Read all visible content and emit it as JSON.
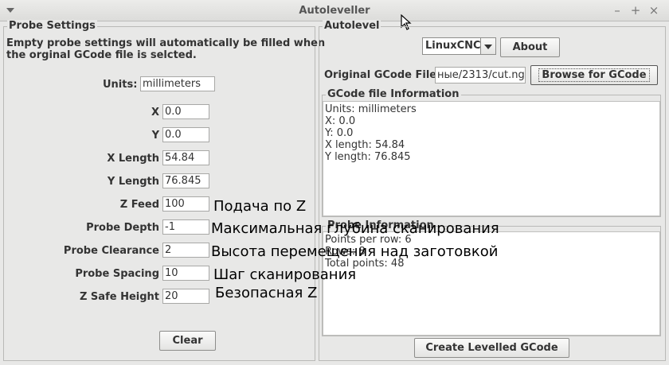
{
  "window": {
    "title": "Autoleveller"
  },
  "probe_settings": {
    "legend": "Probe Settings",
    "note_line1": "Empty probe settings will automatically be filled when",
    "note_line2": "the orginal GCode file is selcted.",
    "units_label": "Units:",
    "units_value": "millimeters",
    "fields": [
      {
        "label": "X",
        "value": "0.0",
        "annotation": ""
      },
      {
        "label": "Y",
        "value": "0.0",
        "annotation": ""
      },
      {
        "label": "X Length",
        "value": "54.84",
        "annotation": ""
      },
      {
        "label": "Y Length",
        "value": "76.845",
        "annotation": ""
      },
      {
        "label": "Z Feed",
        "value": "100",
        "annotation": "Подача по Z"
      },
      {
        "label": "Probe Depth",
        "value": "-1",
        "annotation": "Максимальная глубина сканирования"
      },
      {
        "label": "Probe Clearance",
        "value": "2",
        "annotation": "Высота перемещения над заготовкой"
      },
      {
        "label": "Probe Spacing",
        "value": "10",
        "annotation": "Шаг сканирования"
      },
      {
        "label": "Z Safe Height",
        "value": "20",
        "annotation": "Безопасная Z"
      }
    ],
    "clear_label": "Clear"
  },
  "autolevel": {
    "legend": "Autolevel",
    "controller_selected": "LinuxCNC",
    "about_label": "About",
    "gcode_file_label": "Original GCode File",
    "gcode_file_value": "ные/2313/cut.ngc",
    "browse_label": "Browse for GCode",
    "gcode_info": {
      "legend": "GCode file Information",
      "lines": [
        "Units: millimeters",
        "X: 0.0",
        "Y: 0.0",
        "X length: 54.84",
        "Y length: 76.845"
      ]
    },
    "probe_info": {
      "legend": "Probe Information",
      "lines": [
        "Points per row: 6",
        "Rows: 8",
        "Total points: 48"
      ]
    },
    "create_label": "Create Levelled GCode"
  }
}
